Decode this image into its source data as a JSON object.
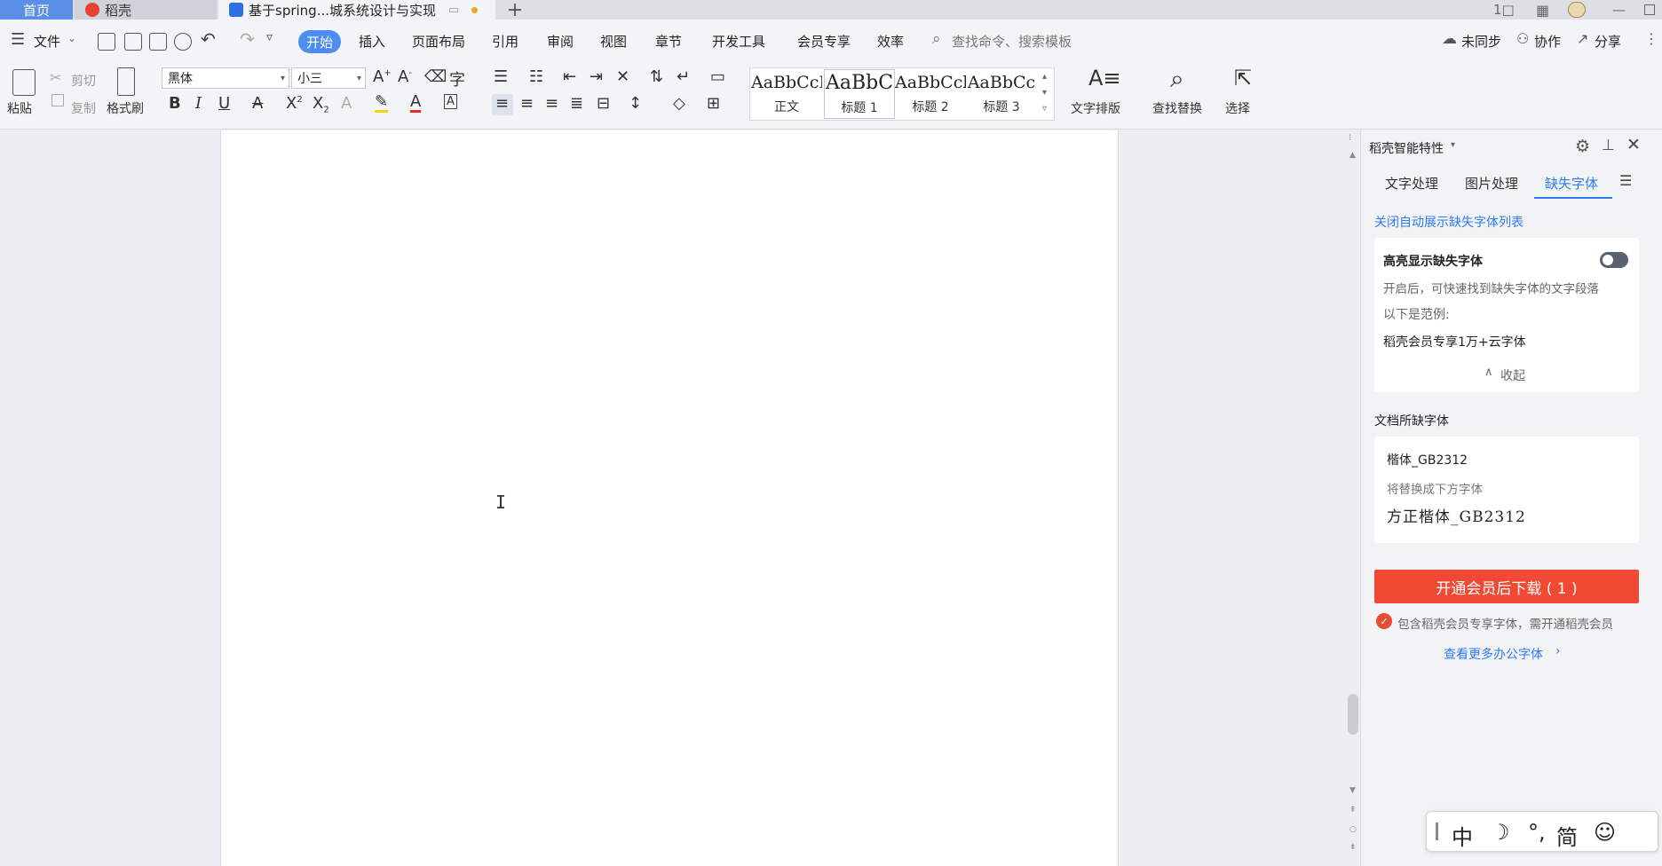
{
  "tabs": {
    "home": "首页",
    "daoke": "稻壳",
    "doc_title": "基于spring...城系统设计与实现",
    "plus": "+"
  },
  "window": {
    "page_indicator": "1□",
    "minimize": "—"
  },
  "menu": {
    "file": "文件",
    "items": [
      "开始",
      "插入",
      "页面布局",
      "引用",
      "审阅",
      "视图",
      "章节",
      "开发工具",
      "会员专享",
      "效率"
    ],
    "search_placeholder": "查找命令、搜索模板",
    "sync": "未同步",
    "collab": "协作",
    "share": "分享"
  },
  "ribbon": {
    "cut": "剪切",
    "copy": "复制",
    "paste": "粘贴",
    "format_painter": "格式刷",
    "font_name": "黑体",
    "font_size": "小三",
    "styles": [
      {
        "sample": "AaBbCcI",
        "name": "正文"
      },
      {
        "sample": "AaBbC",
        "name": "标题 1"
      },
      {
        "sample": "AaBbCcl",
        "name": "标题 2"
      },
      {
        "sample": "AaBbCc",
        "name": "标题 3"
      }
    ],
    "text_layout": "文字排版",
    "find_replace": "查找替换",
    "select": "选择"
  },
  "panel": {
    "title": "稻壳智能特性",
    "tabs": [
      "文字处理",
      "图片处理",
      "缺失字体"
    ],
    "close_auto_link": "关闭自动展示缺失字体列表",
    "highlight_title": "高亮显示缺失字体",
    "highlight_desc": "开启后，可快速找到缺失字体的文字段落",
    "example_label": "以下是范例:",
    "example_text": "稻壳会员专享1万+云字体",
    "collapse": "收起",
    "missing_header": "文档所缺字体",
    "missing_font": "楷体_GB2312",
    "replace_hint": "将替换成下方字体",
    "replacement_font": "方正楷体_GB2312",
    "download_btn": "开通会员后下载 ( 1 )",
    "member_note": "包含稻壳会员专享字体，需开通稻壳会员",
    "more_fonts": "查看更多办公字体"
  },
  "ime": {
    "lang": "中",
    "punct": "°,",
    "charset": "简"
  }
}
